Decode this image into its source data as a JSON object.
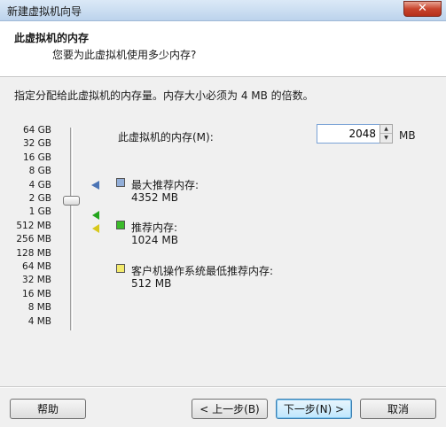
{
  "window": {
    "title": "新建虚拟机向导",
    "close_label": "✕"
  },
  "header": {
    "title": "此虚拟机的内存",
    "subtitle": "您要为此虚拟机使用多少内存?"
  },
  "instruction": "指定分配给此虚拟机的内存量。内存大小必须为 4 MB 的倍数。",
  "slider": {
    "ticks": [
      "64 GB",
      "32 GB",
      "16 GB",
      "8 GB",
      "4 GB",
      "2 GB",
      "1 GB",
      "512 MB",
      "256 MB",
      "128 MB",
      "64 MB",
      "32 MB",
      "16 MB",
      "8 MB",
      "4 MB"
    ],
    "current_value_mb": 2048
  },
  "memory": {
    "label": "此虚拟机的内存(M):",
    "value": "2048",
    "unit": "MB"
  },
  "legend": {
    "max": {
      "label": "最大推荐内存:",
      "value": "4352 MB",
      "color": "#4b74b5"
    },
    "recommended": {
      "label": "推荐内存:",
      "value": "1024 MB",
      "color": "#23a51c"
    },
    "min": {
      "label": "客户机操作系统最低推荐内存:",
      "value": "512 MB",
      "color": "#d8c81c"
    }
  },
  "buttons": {
    "help": "帮助",
    "back": "< 上一步(B)",
    "next": "下一步(N) >",
    "cancel": "取消"
  }
}
